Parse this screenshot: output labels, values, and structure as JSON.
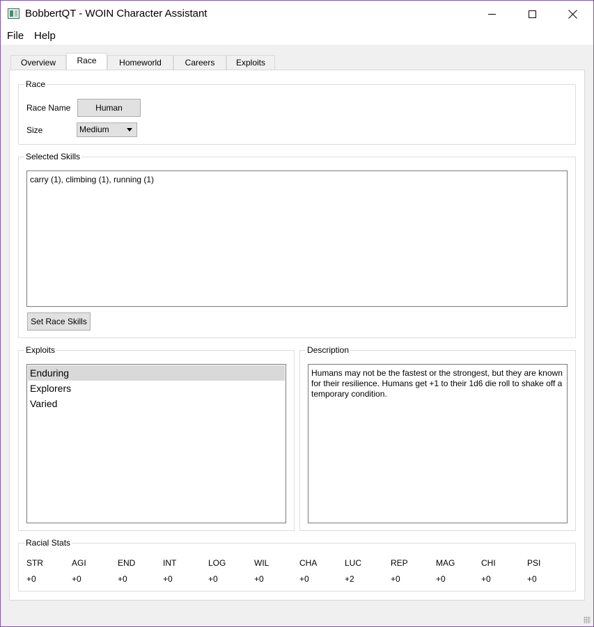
{
  "window": {
    "title": "BobbertQT - WOIN Character Assistant"
  },
  "menu": {
    "file": "File",
    "help": "Help"
  },
  "tabs": [
    {
      "label": "Overview"
    },
    {
      "label": "Race"
    },
    {
      "label": "Homeworld"
    },
    {
      "label": "Careers"
    },
    {
      "label": "Exploits"
    }
  ],
  "race": {
    "group_title": "Race",
    "name_label": "Race Name",
    "name_value": "Human",
    "size_label": "Size",
    "size_value": "Medium"
  },
  "skills": {
    "group_title": "Selected Skills",
    "text": "carry (1), climbing (1), running (1)",
    "button": "Set Race Skills"
  },
  "exploits": {
    "group_title": "Exploits",
    "items": [
      "Enduring",
      "Explorers",
      "Varied"
    ],
    "selected": "Enduring"
  },
  "description": {
    "group_title": "Description",
    "text": "Humans may not be the fastest or the strongest, but they are known for their resilience. Humans get +1 to their 1d6 die roll to shake off a temporary condition."
  },
  "stats": {
    "group_title": "Racial Stats",
    "items": [
      {
        "name": "STR",
        "value": "+0"
      },
      {
        "name": "AGI",
        "value": "+0"
      },
      {
        "name": "END",
        "value": "+0"
      },
      {
        "name": "INT",
        "value": "+0"
      },
      {
        "name": "LOG",
        "value": "+0"
      },
      {
        "name": "WIL",
        "value": "+0"
      },
      {
        "name": "CHA",
        "value": "+0"
      },
      {
        "name": "LUC",
        "value": "+2"
      },
      {
        "name": "REP",
        "value": "+0"
      },
      {
        "name": "MAG",
        "value": "+0"
      },
      {
        "name": "CHI",
        "value": "+0"
      },
      {
        "name": "PSI",
        "value": "+0"
      }
    ]
  }
}
